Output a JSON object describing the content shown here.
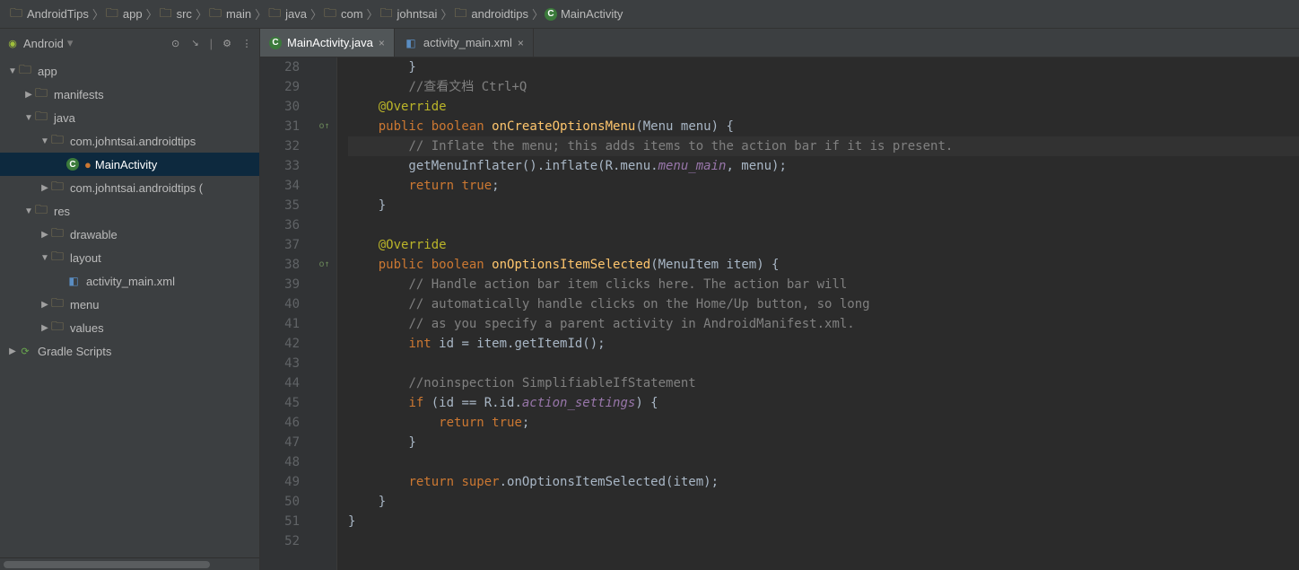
{
  "breadcrumbs": [
    "AndroidTips",
    "app",
    "src",
    "main",
    "java",
    "com",
    "johntsai",
    "androidtips",
    "MainActivity"
  ],
  "sidebar": {
    "mode": "Android",
    "tree": [
      {
        "depth": 0,
        "arrow": "▼",
        "icon": "mod",
        "label": "app"
      },
      {
        "depth": 1,
        "arrow": "▶",
        "icon": "folder",
        "label": "manifests"
      },
      {
        "depth": 1,
        "arrow": "▼",
        "icon": "folder",
        "label": "java"
      },
      {
        "depth": 2,
        "arrow": "▼",
        "icon": "pkg",
        "label": "com.johntsai.androidtips"
      },
      {
        "depth": 3,
        "arrow": "",
        "icon": "class",
        "label": "MainActivity",
        "sel": true,
        "badge": "●"
      },
      {
        "depth": 2,
        "arrow": "▶",
        "icon": "pkg",
        "label": "com.johntsai.androidtips ("
      },
      {
        "depth": 1,
        "arrow": "▼",
        "icon": "folder",
        "label": "res"
      },
      {
        "depth": 2,
        "arrow": "▶",
        "icon": "folder",
        "label": "drawable"
      },
      {
        "depth": 2,
        "arrow": "▼",
        "icon": "folder",
        "label": "layout"
      },
      {
        "depth": 3,
        "arrow": "",
        "icon": "xml",
        "label": "activity_main.xml"
      },
      {
        "depth": 2,
        "arrow": "▶",
        "icon": "folder",
        "label": "menu"
      },
      {
        "depth": 2,
        "arrow": "▶",
        "icon": "folder",
        "label": "values"
      },
      {
        "depth": 0,
        "arrow": "▶",
        "icon": "gradle",
        "label": "Gradle Scripts"
      }
    ]
  },
  "tabs": [
    {
      "icon": "class",
      "label": "MainActivity.java",
      "active": true
    },
    {
      "icon": "xml",
      "label": "activity_main.xml",
      "active": false
    }
  ],
  "code": {
    "start": 28,
    "lines": [
      {
        "html": "        }"
      },
      {
        "html": "        <span class='cmt'>//查看文档 Ctrl+Q</span>"
      },
      {
        "html": "    <span class='anno'>@Override</span>"
      },
      {
        "html": "    <span class='kw'>public boolean</span> <span class='fn'>onCreateOptionsMenu</span>(Menu menu) {",
        "mark": "o↑"
      },
      {
        "html": "        <span class='cmt'>// Inflate the menu; this adds items to the action bar if it is present.</span>",
        "hl": true
      },
      {
        "html": "        getMenuInflater().inflate(R.menu.<span class='fld'>menu_main</span>, menu);"
      },
      {
        "html": "        <span class='kw'>return true</span>;"
      },
      {
        "html": "    }"
      },
      {
        "html": ""
      },
      {
        "html": "    <span class='anno'>@Override</span>"
      },
      {
        "html": "    <span class='kw'>public boolean</span> <span class='fn'>onOptionsItemSelected</span>(MenuItem item) {",
        "mark": "o↑"
      },
      {
        "html": "        <span class='cmt'>// Handle action bar item clicks here. The action bar will</span>"
      },
      {
        "html": "        <span class='cmt'>// automatically handle clicks on the Home/Up button, so long</span>"
      },
      {
        "html": "        <span class='cmt'>// as you specify a parent activity in AndroidManifest.xml.</span>"
      },
      {
        "html": "        <span class='kw'>int</span> id = item.getItemId();"
      },
      {
        "html": ""
      },
      {
        "html": "        <span class='cmt'>//noinspection SimplifiableIfStatement</span>"
      },
      {
        "html": "        <span class='kw'>if</span> (id == R.id.<span class='fld'>action_settings</span>) {"
      },
      {
        "html": "            <span class='kw'>return true</span>;"
      },
      {
        "html": "        }"
      },
      {
        "html": ""
      },
      {
        "html": "        <span class='kw'>return super</span>.onOptionsItemSelected(item);"
      },
      {
        "html": "    }"
      },
      {
        "html": "}"
      },
      {
        "html": ""
      }
    ]
  }
}
